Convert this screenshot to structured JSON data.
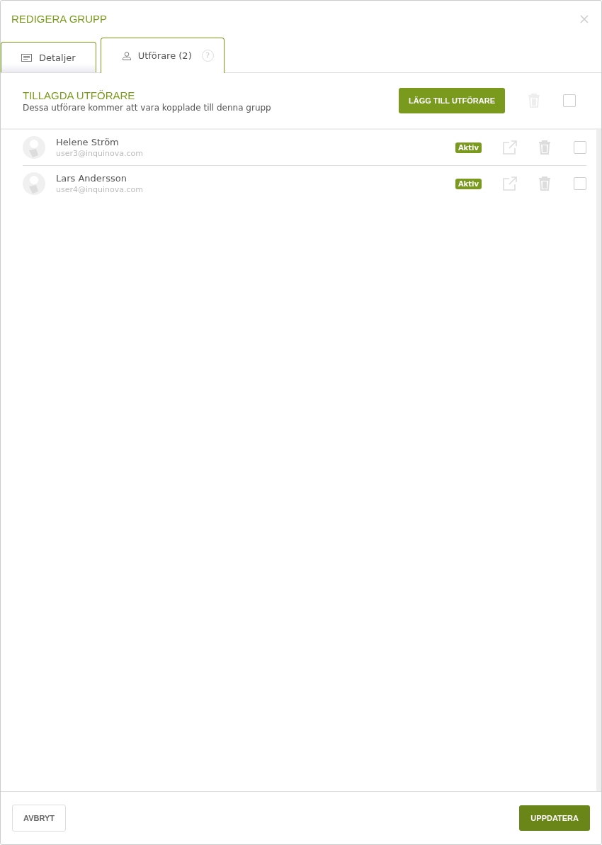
{
  "dialog": {
    "title": "REDIGERA GRUPP"
  },
  "tabs": [
    {
      "label": "Detaljer",
      "selected": false
    },
    {
      "label": "Utförare (2)",
      "selected": true,
      "help": "?"
    }
  ],
  "section": {
    "title": "TILLAGDA UTFÖRARE",
    "subtitle": "Dessa utförare kommer att vara kopplade till denna grupp",
    "add_button": "LÄGG TILL UTFÖRARE",
    "select_all": {
      "checked": false
    }
  },
  "performers": [
    {
      "name": "Helene Ström",
      "email": "user3@inquinova.com",
      "status": "Aktiv",
      "checked": false
    },
    {
      "name": "Lars Andersson",
      "email": "user4@inquinova.com",
      "status": "Aktiv",
      "checked": false
    }
  ],
  "footer": {
    "cancel": "AVBRYT",
    "submit": "UPPDATERA"
  }
}
